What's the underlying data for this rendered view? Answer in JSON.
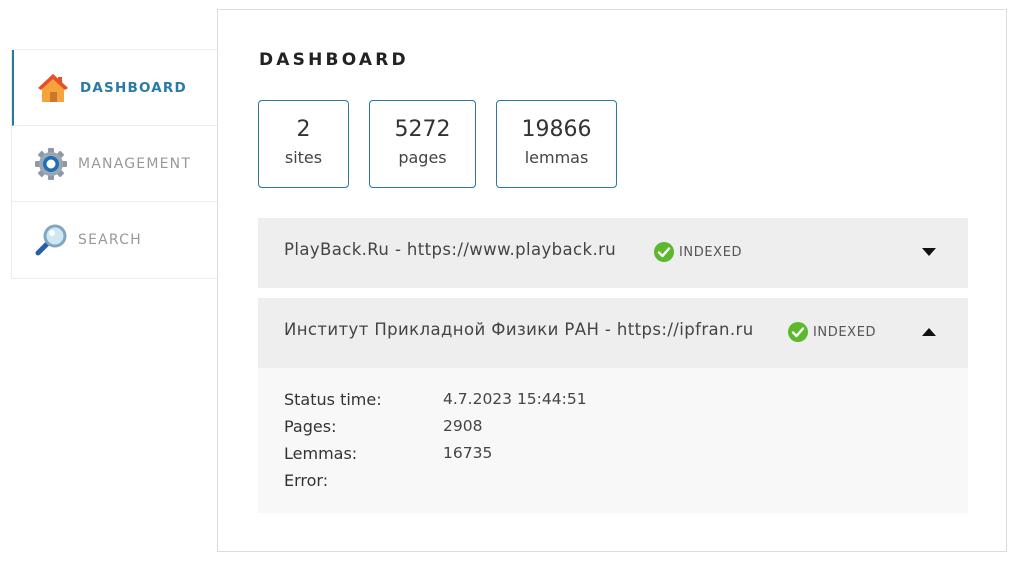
{
  "sidebar": {
    "items": [
      {
        "label": "DASHBOARD",
        "icon": "home-icon",
        "active": true
      },
      {
        "label": "MANAGEMENT",
        "icon": "gear-icon",
        "active": false
      },
      {
        "label": "SEARCH",
        "icon": "magnifier-icon",
        "active": false
      }
    ]
  },
  "main": {
    "title": "DASHBOARD",
    "stats": [
      {
        "value": "2",
        "label": "sites"
      },
      {
        "value": "5272",
        "label": "pages"
      },
      {
        "value": "19866",
        "label": "lemmas"
      }
    ],
    "sites": [
      {
        "title": "PlayBack.Ru - https://www.playback.ru",
        "status": "INDEXED",
        "expanded": false
      },
      {
        "title": "Институт Прикладной Физики РАН - https://ipfran.ru",
        "status": "INDEXED",
        "expanded": true,
        "details": {
          "status_time_label": "Status time:",
          "status_time": "4.7.2023 15:44:51",
          "pages_label": "Pages:",
          "pages": "2908",
          "lemmas_label": "Lemmas:",
          "lemmas": "16735",
          "error_label": "Error:",
          "error": ""
        }
      }
    ]
  },
  "colors": {
    "accent": "#2a7a9e",
    "status_ok": "#5cb82c",
    "site_header_bg": "#eeeeee",
    "site_body_bg": "#f8f8f8"
  }
}
